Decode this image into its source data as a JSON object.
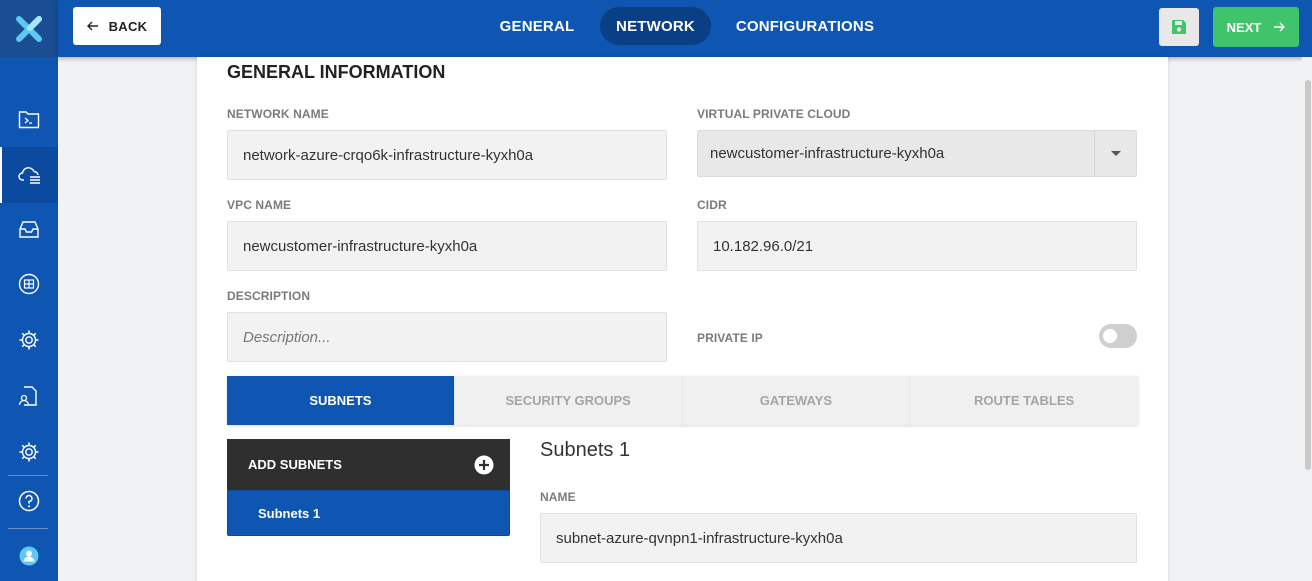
{
  "colors": {
    "primary": "#0f56b3",
    "primary_dark": "#0a3f86",
    "success": "#3fc36b",
    "dark_panel": "#2f2f2f"
  },
  "sidebar": {
    "logo_icon": "x-logo-icon",
    "items": [
      {
        "icon": "terminal-folder-icon",
        "active": false
      },
      {
        "icon": "cloud-list-icon",
        "active": true
      },
      {
        "icon": "inbox-tray-icon",
        "active": false
      },
      {
        "icon": "box-grid-icon",
        "active": false
      },
      {
        "icon": "gear-icon",
        "active": false
      },
      {
        "icon": "document-user-icon",
        "active": false
      },
      {
        "icon": "gear-icon",
        "active": false
      },
      {
        "icon": "help-circle-icon",
        "active": false
      },
      {
        "icon": "user-avatar-icon",
        "active": false
      }
    ]
  },
  "topbar": {
    "back_label": "BACK",
    "tabs": [
      {
        "label": "GENERAL",
        "active": false
      },
      {
        "label": "NETWORK",
        "active": true
      },
      {
        "label": "CONFIGURATIONS",
        "active": false
      }
    ],
    "save_icon": "floppy-save-icon",
    "next_label": "NEXT"
  },
  "general": {
    "title": "GENERAL INFORMATION",
    "network_name": {
      "label": "NETWORK NAME",
      "value": "network-azure-crqo6k-infrastructure-kyxh0a"
    },
    "vpc": {
      "label": "VIRTUAL PRIVATE CLOUD",
      "value": "newcustomer-infrastructure-kyxh0a"
    },
    "vpc_name": {
      "label": "VPC NAME",
      "value": "newcustomer-infrastructure-kyxh0a"
    },
    "cidr": {
      "label": "CIDR",
      "value": "10.182.96.0/21"
    },
    "description": {
      "label": "DESCRIPTION",
      "placeholder": "Description..."
    },
    "private_ip": {
      "label": "PRIVATE IP",
      "enabled": false
    }
  },
  "subtabs": [
    {
      "label": "SUBNETS",
      "active": true
    },
    {
      "label": "SECURITY GROUPS",
      "active": false
    },
    {
      "label": "GATEWAYS",
      "active": false
    },
    {
      "label": "ROUTE TABLES",
      "active": false
    }
  ],
  "subnets": {
    "add_label": "ADD SUBNETS",
    "items": [
      {
        "label": "Subnets 1"
      }
    ],
    "detail": {
      "title": "Subnets 1",
      "name_label": "NAME",
      "name_value": "subnet-azure-qvnpn1-infrastructure-kyxh0a"
    }
  }
}
